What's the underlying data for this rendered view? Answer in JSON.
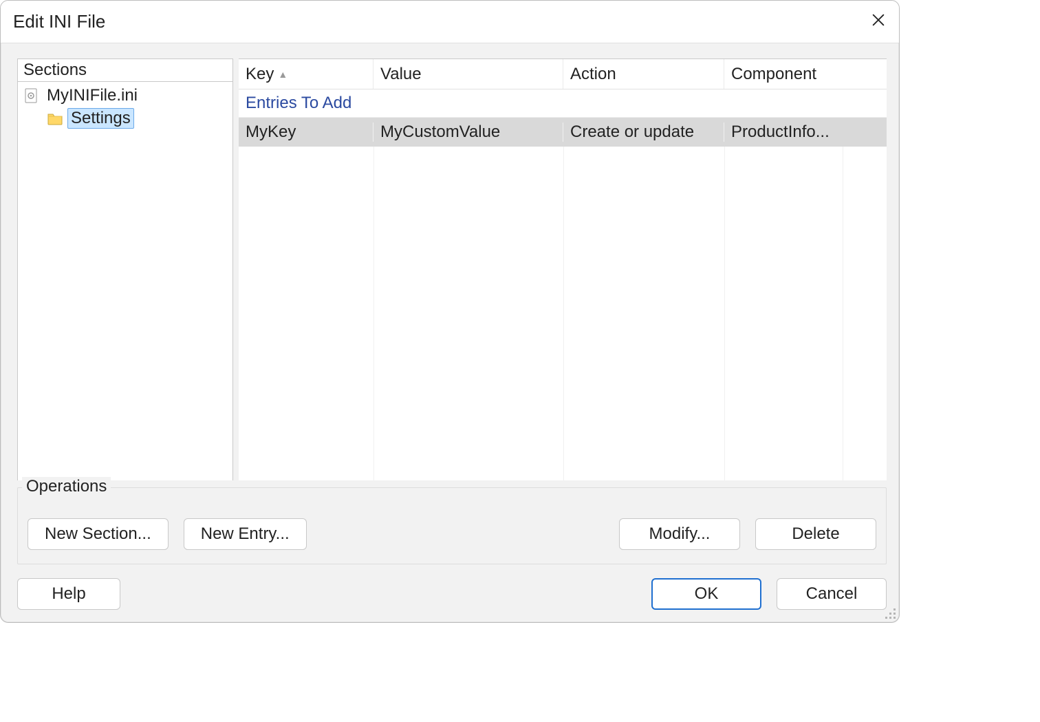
{
  "dialog": {
    "title": "Edit INI File"
  },
  "tree": {
    "header": "Sections",
    "file_name": "MyINIFile.ini",
    "section_name": "Settings"
  },
  "list": {
    "columns": {
      "key": "Key",
      "value": "Value",
      "action": "Action",
      "component": "Component"
    },
    "group_label": "Entries To Add",
    "rows": [
      {
        "key": "MyKey",
        "value": "MyCustomValue",
        "action": "Create or update",
        "component": "ProductInfo..."
      }
    ]
  },
  "operations": {
    "legend": "Operations",
    "new_section": "New Section...",
    "new_entry": "New Entry...",
    "modify": "Modify...",
    "delete": "Delete"
  },
  "footer": {
    "help": "Help",
    "ok": "OK",
    "cancel": "Cancel"
  }
}
